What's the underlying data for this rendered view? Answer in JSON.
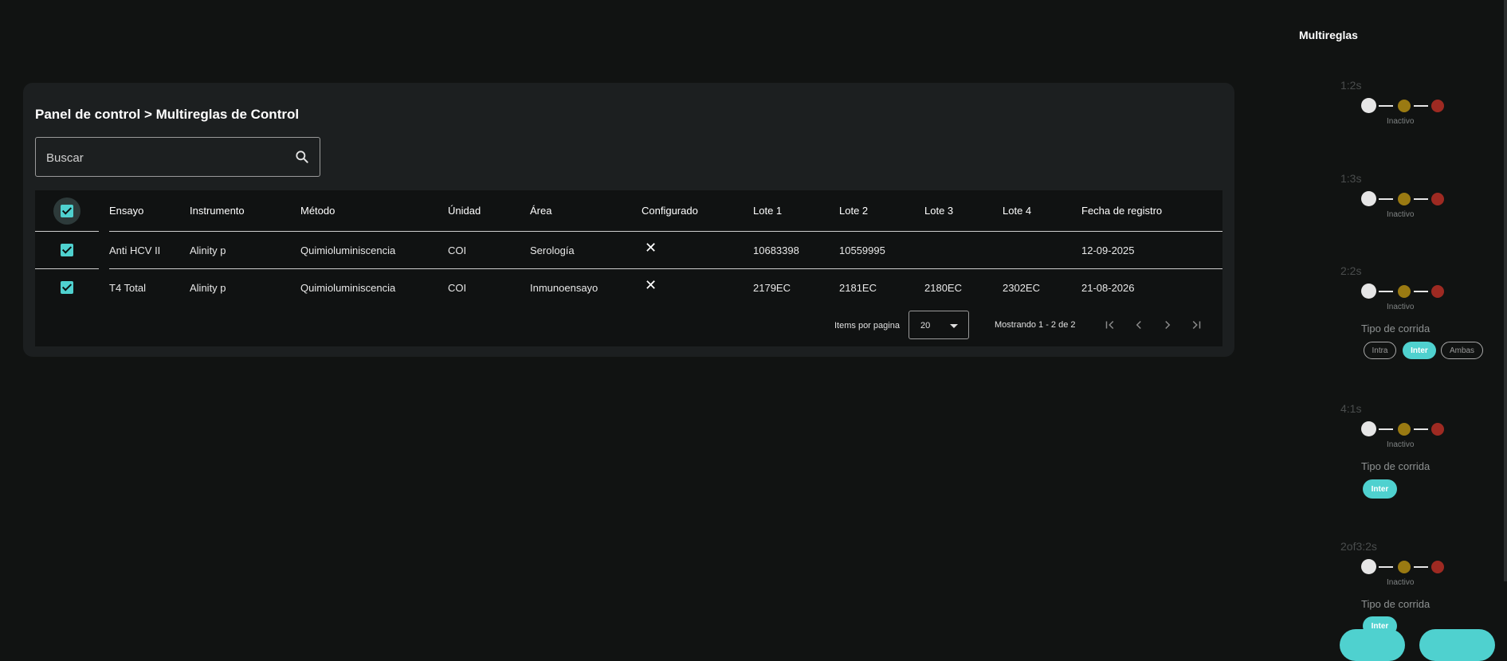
{
  "breadcrumb": "Panel de control > Multireglas de Control",
  "search": {
    "placeholder": "Buscar",
    "value": ""
  },
  "table": {
    "columns": [
      "Ensayo",
      "Instrumento",
      "Método",
      "Únidad",
      "Área",
      "Configurado",
      "Lote 1",
      "Lote 2",
      "Lote 3",
      "Lote 4",
      "Fecha de registro"
    ],
    "rows": [
      {
        "checked": true,
        "ensayo": "Anti HCV II",
        "instrumento": "Alinity p",
        "metodo": "Quimioluminiscencia",
        "unidad": "COI",
        "area": "Serología",
        "configurado": "✕",
        "lote1": "10683398",
        "lote2": "10559995",
        "lote3": "",
        "lote4": "",
        "fecha": "12-09-2025"
      },
      {
        "checked": true,
        "ensayo": "T4 Total",
        "instrumento": "Alinity p",
        "metodo": "Quimioluminiscencia",
        "unidad": "COI",
        "area": "Inmunoensayo",
        "configurado": "✕",
        "lote1": "2179EC",
        "lote2": "2181EC",
        "lote3": "2180EC",
        "lote4": "2302EC",
        "fecha": "21-08-2026"
      }
    ]
  },
  "pager": {
    "items_label": "Items por pagina",
    "page_size": "20",
    "range": "Mostrando 1 - 2 de 2"
  },
  "sidebar": {
    "title": "Multireglas",
    "rules": [
      {
        "name": "1:2s",
        "status": "Inactivo"
      },
      {
        "name": "1:3s",
        "status": "Inactivo"
      },
      {
        "name": "2:2s",
        "status": "Inactivo",
        "tipo_label": "Tipo de corrida",
        "options": [
          "Intra",
          "Inter",
          "Ambas"
        ],
        "selected": "Inter"
      },
      {
        "name": "4:1s",
        "status": "Inactivo",
        "tipo_label": "Tipo de corrida",
        "options": [
          "Inter"
        ],
        "selected": "Inter"
      },
      {
        "name": "2of3:2s",
        "status": "Inactivo",
        "tipo_label": "Tipo de corrida",
        "options": [
          "Inter"
        ],
        "selected": "Inter"
      }
    ]
  },
  "colors": {
    "accent": "#4fd1cf",
    "background": "#111312",
    "panel": "#1c1f20"
  }
}
